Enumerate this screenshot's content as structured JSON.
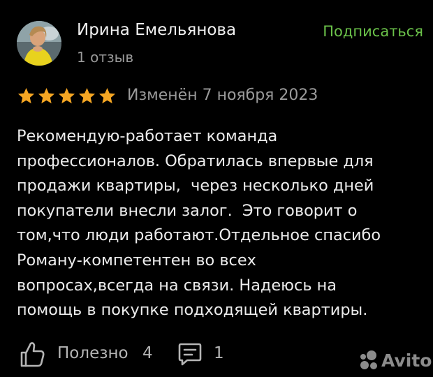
{
  "accent_color": "#6bc24a",
  "star_color": "#f5a623",
  "author": {
    "name": "Ирина Емельянова",
    "reviews_count_label": "1 отзыв",
    "subscribe_label": "Подписаться"
  },
  "review": {
    "rating": 5,
    "rating_max": 5,
    "date_label": "Изменён 7 ноября 2023",
    "text_lines": [
      "Рекомендую-работает команда",
      "профессионалов. Обратилась впервые для",
      "продажи квартиры,  через несколько дней",
      "покупатели внесли залог.  Это говорит о",
      "том,что люди работают.Отдельное спасибо",
      "Роману-компетентен во всех",
      "вопросах,всегда на связи. Надеюсь на",
      "помощь в покупке подходящей квартиры."
    ]
  },
  "footer": {
    "like_icon": "thumbs-up-icon",
    "helpful_label": "Полезно",
    "helpful_count": "4",
    "comment_icon": "comment-icon",
    "comments_count": "1"
  },
  "watermark": {
    "text": "Avito"
  }
}
